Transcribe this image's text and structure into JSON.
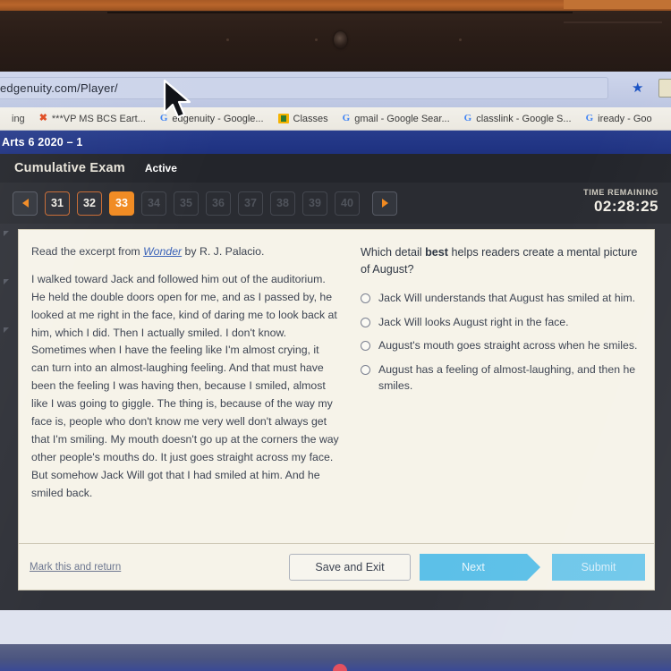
{
  "browser": {
    "url": "edgenuity.com/Player/",
    "star_icon": "star-icon",
    "bookmarks": [
      {
        "icon": "text-bookmark",
        "label": "ing"
      },
      {
        "icon": "x-icon",
        "label": "***VP MS BCS Eart..."
      },
      {
        "icon": "google-icon",
        "label": "edgenuity - Google..."
      },
      {
        "icon": "classroom-icon",
        "label": "Classes"
      },
      {
        "icon": "google-icon",
        "label": "gmail - Google Sear..."
      },
      {
        "icon": "google-icon",
        "label": "classlink - Google S..."
      },
      {
        "icon": "google-icon",
        "label": "iready - Goo"
      }
    ]
  },
  "course": {
    "title": "Arts 6 2020 – 1"
  },
  "exam": {
    "name": "Cumulative Exam",
    "status": "Active",
    "timer_label": "TIME REMAINING",
    "timer_value": "02:28:25",
    "prev_arrow": "previous-question-arrow",
    "next_arrow": "next-question-arrow",
    "questions": [
      {
        "number": "31",
        "state": "visited"
      },
      {
        "number": "32",
        "state": "visited"
      },
      {
        "number": "33",
        "state": "active"
      },
      {
        "number": "34",
        "state": "disabled"
      },
      {
        "number": "35",
        "state": "disabled"
      },
      {
        "number": "36",
        "state": "disabled"
      },
      {
        "number": "37",
        "state": "disabled"
      },
      {
        "number": "38",
        "state": "disabled"
      },
      {
        "number": "39",
        "state": "disabled"
      },
      {
        "number": "40",
        "state": "disabled"
      }
    ]
  },
  "passage": {
    "lead_before": "Read the excerpt from ",
    "lead_link": "Wonder",
    "lead_after": " by R. J. Palacio.",
    "text": "I walked toward Jack and followed him out of the auditorium. He held the double doors open for me, and as I passed by, he looked at me right in the face, kind of daring me to look back at him, which I did. Then I actually smiled. I don't know. Sometimes when I have the feeling like I'm almost crying, it can turn into an almost-laughing feeling. And that must have been the feeling I was having then, because I smiled, almost like I was going to giggle. The thing is, because of the way my face is, people who don't know me very well don't always get that I'm smiling. My mouth doesn't go up at the corners the way other people's mouths do. It just goes straight across my face. But somehow Jack Will got that I had smiled at him. And he smiled back."
  },
  "question": {
    "prompt_before": "Which detail ",
    "prompt_bold": "best",
    "prompt_after": " helps readers create a mental picture of August?",
    "options": [
      {
        "label": "Jack Will understands that August has smiled at him.",
        "selected": false
      },
      {
        "label": "Jack Will looks August right in the face.",
        "selected": false
      },
      {
        "label": "August's mouth goes straight across when he smiles.",
        "selected": false
      },
      {
        "label": "August has a feeling of almost-laughing, and then he smiles.",
        "selected": false
      }
    ]
  },
  "footer": {
    "mark_link": "Mark this and return",
    "save_label": "Save and Exit",
    "next_label": "Next",
    "submit_label": "Submit"
  },
  "colors": {
    "accent_orange": "#f18a21",
    "course_blue": "#27398c",
    "cyan_next": "#5cc0e8",
    "cyan_submit": "#6ec7ea",
    "paper": "#f6f3e9"
  }
}
